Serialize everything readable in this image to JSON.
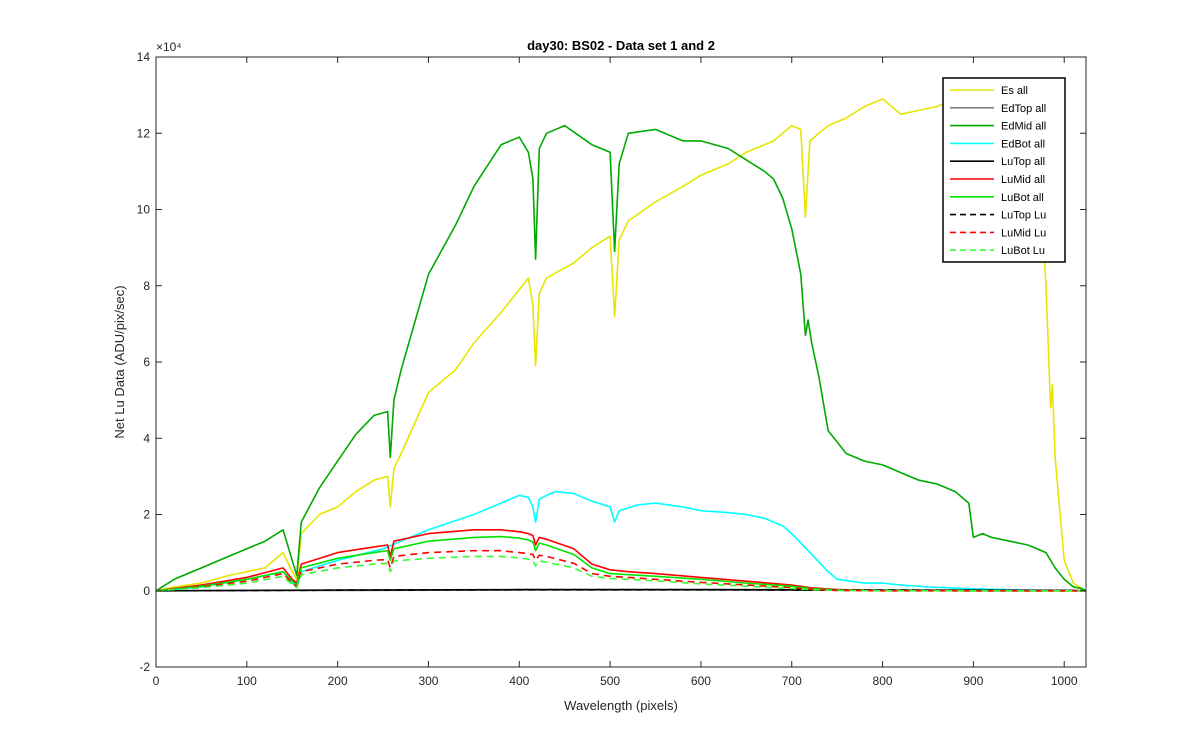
{
  "chart_data": {
    "type": "line",
    "title": "day30: BS02 - Data set 1 and 2",
    "xlabel": "Wavelength (pixels)",
    "ylabel": "Net Lu Data (ADU/pix/sec)",
    "y_exponent_label": "×10⁴",
    "xlim": [
      0,
      1024
    ],
    "ylim": [
      -2,
      14
    ],
    "x_ticks": [
      0,
      100,
      200,
      300,
      400,
      500,
      600,
      700,
      800,
      900,
      1000
    ],
    "y_ticks": [
      -2,
      0,
      2,
      4,
      6,
      8,
      10,
      12,
      14
    ],
    "grid": false,
    "legend_position": "top-right",
    "series": [
      {
        "name": "Es  all",
        "color": "#e6e600",
        "dash": "solid",
        "x": [
          0,
          20,
          50,
          80,
          100,
          120,
          140,
          150,
          155,
          160,
          180,
          200,
          220,
          240,
          255,
          258,
          262,
          270,
          300,
          330,
          350,
          380,
          400,
          410,
          415,
          418,
          422,
          430,
          460,
          480,
          500,
          505,
          510,
          520,
          550,
          580,
          600,
          630,
          650,
          680,
          700,
          710,
          715,
          720,
          740,
          760,
          780,
          800,
          820,
          840,
          860,
          880,
          900,
          920,
          940,
          960,
          975,
          980,
          985,
          987,
          990,
          1000,
          1010,
          1020,
          1024
        ],
        "y": [
          0,
          0.1,
          0.2,
          0.4,
          0.5,
          0.6,
          1.0,
          0.5,
          0.3,
          1.5,
          2.0,
          2.2,
          2.6,
          2.9,
          3.0,
          2.2,
          3.2,
          3.6,
          5.2,
          5.8,
          6.5,
          7.3,
          7.9,
          8.2,
          7.5,
          5.9,
          7.8,
          8.2,
          8.6,
          9.0,
          9.3,
          7.2,
          9.2,
          9.7,
          10.2,
          10.6,
          10.9,
          11.2,
          11.5,
          11.8,
          12.2,
          12.1,
          9.8,
          11.8,
          12.2,
          12.4,
          12.7,
          12.9,
          12.5,
          12.6,
          12.7,
          12.9,
          12.8,
          12.9,
          12.9,
          11.5,
          10.0,
          8.0,
          4.8,
          5.4,
          3.5,
          0.8,
          0.2,
          0.05,
          0
        ]
      },
      {
        "name": "EdTop  all",
        "color": "#808080",
        "dash": "solid",
        "x": [
          0,
          200,
          400,
          600,
          800,
          1000,
          1024
        ],
        "y": [
          0,
          0.01,
          0.02,
          0.02,
          0.01,
          0.005,
          0
        ]
      },
      {
        "name": "EdMid  all",
        "color": "#00aa00",
        "dash": "solid",
        "x": [
          0,
          20,
          50,
          80,
          100,
          120,
          140,
          150,
          155,
          160,
          180,
          200,
          220,
          240,
          255,
          258,
          262,
          270,
          300,
          330,
          350,
          380,
          400,
          410,
          415,
          418,
          422,
          430,
          450,
          480,
          500,
          505,
          510,
          520,
          550,
          580,
          600,
          630,
          650,
          670,
          680,
          690,
          700,
          710,
          715,
          718,
          722,
          730,
          740,
          760,
          780,
          800,
          820,
          840,
          860,
          880,
          895,
          900,
          910,
          920,
          940,
          960,
          980,
          990,
          1000,
          1010,
          1020,
          1024
        ],
        "y": [
          0,
          0.3,
          0.6,
          0.9,
          1.1,
          1.3,
          1.6,
          0.8,
          0.4,
          1.8,
          2.7,
          3.4,
          4.1,
          4.6,
          4.7,
          3.5,
          5.0,
          5.8,
          8.3,
          9.6,
          10.6,
          11.7,
          11.9,
          11.5,
          10.8,
          8.7,
          11.6,
          12.0,
          12.2,
          11.7,
          11.5,
          8.9,
          11.2,
          12.0,
          12.1,
          11.8,
          11.8,
          11.6,
          11.3,
          11.0,
          10.8,
          10.3,
          9.5,
          8.3,
          6.7,
          7.1,
          6.5,
          5.6,
          4.2,
          3.6,
          3.4,
          3.3,
          3.1,
          2.9,
          2.8,
          2.6,
          2.3,
          1.4,
          1.5,
          1.4,
          1.3,
          1.2,
          1.0,
          0.6,
          0.3,
          0.1,
          0.05,
          0
        ]
      },
      {
        "name": "EdBot  all",
        "color": "#00ffff",
        "dash": "solid",
        "x": [
          0,
          50,
          100,
          140,
          150,
          155,
          160,
          200,
          250,
          300,
          350,
          380,
          400,
          410,
          415,
          418,
          422,
          430,
          440,
          460,
          480,
          500,
          505,
          510,
          530,
          550,
          580,
          600,
          630,
          650,
          670,
          690,
          700,
          720,
          740,
          750,
          780,
          800,
          820,
          850,
          900,
          950,
          1000,
          1024
        ],
        "y": [
          0,
          0.1,
          0.3,
          0.5,
          0.2,
          0.1,
          0.5,
          0.8,
          1.1,
          1.6,
          2.0,
          2.3,
          2.5,
          2.45,
          2.2,
          1.8,
          2.4,
          2.5,
          2.6,
          2.55,
          2.35,
          2.2,
          1.8,
          2.1,
          2.25,
          2.3,
          2.2,
          2.1,
          2.05,
          2.0,
          1.9,
          1.7,
          1.5,
          1.0,
          0.5,
          0.3,
          0.2,
          0.2,
          0.15,
          0.1,
          0.05,
          0.02,
          0.01,
          0
        ]
      },
      {
        "name": "LuTop  all",
        "color": "#000000",
        "dash": "solid",
        "x": [
          0,
          200,
          400,
          600,
          800,
          1000,
          1024
        ],
        "y": [
          0,
          0.02,
          0.03,
          0.03,
          0.02,
          0.01,
          0
        ]
      },
      {
        "name": "LuMid  all",
        "color": "#ff0000",
        "dash": "solid",
        "x": [
          0,
          50,
          100,
          140,
          150,
          155,
          160,
          200,
          240,
          255,
          258,
          262,
          300,
          350,
          380,
          400,
          410,
          415,
          418,
          422,
          430,
          460,
          480,
          500,
          520,
          550,
          600,
          650,
          700,
          720,
          750,
          800,
          900,
          1024
        ],
        "y": [
          0,
          0.15,
          0.35,
          0.6,
          0.3,
          0.2,
          0.7,
          1.0,
          1.15,
          1.2,
          0.9,
          1.3,
          1.5,
          1.6,
          1.6,
          1.55,
          1.5,
          1.45,
          1.2,
          1.4,
          1.35,
          1.1,
          0.7,
          0.55,
          0.5,
          0.45,
          0.35,
          0.25,
          0.15,
          0.08,
          0.03,
          0.01,
          0,
          0
        ]
      },
      {
        "name": "LuBot  all",
        "color": "#00e600",
        "dash": "solid",
        "x": [
          0,
          50,
          100,
          140,
          150,
          155,
          160,
          200,
          240,
          255,
          258,
          262,
          300,
          350,
          380,
          400,
          410,
          415,
          418,
          422,
          430,
          460,
          480,
          500,
          520,
          550,
          600,
          650,
          700,
          720,
          750,
          800,
          900,
          1024
        ],
        "y": [
          0,
          0.12,
          0.3,
          0.5,
          0.25,
          0.15,
          0.6,
          0.85,
          1.0,
          1.05,
          0.8,
          1.1,
          1.3,
          1.4,
          1.42,
          1.38,
          1.33,
          1.28,
          1.05,
          1.25,
          1.2,
          0.95,
          0.6,
          0.45,
          0.42,
          0.38,
          0.3,
          0.2,
          0.12,
          0.06,
          0.02,
          0.01,
          0,
          0
        ]
      },
      {
        "name": "LuTop  Lu",
        "color": "#000000",
        "dash": "dashed",
        "x": [
          0,
          200,
          400,
          600,
          800,
          1000,
          1024
        ],
        "y": [
          0,
          0.015,
          0.025,
          0.025,
          0.015,
          0.008,
          0
        ]
      },
      {
        "name": "LuMid  Lu",
        "color": "#ff0000",
        "dash": "dashed",
        "x": [
          0,
          50,
          100,
          140,
          150,
          155,
          160,
          200,
          240,
          255,
          258,
          262,
          300,
          350,
          380,
          400,
          410,
          415,
          418,
          422,
          430,
          460,
          480,
          500,
          520,
          550,
          600,
          650,
          700,
          720,
          750,
          800,
          900,
          1024
        ],
        "y": [
          0,
          0.1,
          0.25,
          0.45,
          0.2,
          0.1,
          0.5,
          0.7,
          0.8,
          0.82,
          0.6,
          0.9,
          1.0,
          1.05,
          1.05,
          1.0,
          0.97,
          0.95,
          0.8,
          0.93,
          0.9,
          0.72,
          0.45,
          0.38,
          0.35,
          0.3,
          0.22,
          0.15,
          0.08,
          0.04,
          0.01,
          0,
          0,
          0
        ]
      },
      {
        "name": "LuBot  Lu",
        "color": "#33ff33",
        "dash": "dashed",
        "x": [
          0,
          50,
          100,
          140,
          150,
          155,
          160,
          200,
          240,
          255,
          258,
          262,
          300,
          350,
          380,
          400,
          410,
          415,
          418,
          422,
          430,
          460,
          480,
          500,
          520,
          550,
          600,
          650,
          700,
          720,
          750,
          800,
          900,
          1024
        ],
        "y": [
          0,
          0.08,
          0.2,
          0.38,
          0.15,
          0.08,
          0.42,
          0.6,
          0.7,
          0.72,
          0.5,
          0.78,
          0.85,
          0.9,
          0.9,
          0.86,
          0.83,
          0.8,
          0.65,
          0.78,
          0.75,
          0.6,
          0.38,
          0.32,
          0.3,
          0.26,
          0.18,
          0.12,
          0.06,
          0.03,
          0.01,
          0,
          0,
          0
        ]
      }
    ]
  }
}
